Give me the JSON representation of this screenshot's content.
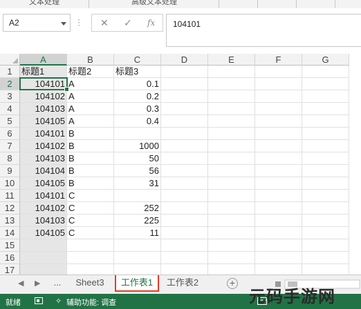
{
  "ribbon": {
    "group_left": "文本处理",
    "group_right": "高级文本处理"
  },
  "formula_bar": {
    "name_box": "A2",
    "cancel_symbol": "✕",
    "enter_symbol": "✓",
    "fx_label": "fx",
    "formula_value": "104101"
  },
  "columns": [
    "A",
    "B",
    "C",
    "D",
    "E",
    "F",
    "G"
  ],
  "selected_column": "A",
  "rows": [
    {
      "n": "1",
      "a": "标题1",
      "b": "标题2",
      "c": "标题3"
    },
    {
      "n": "2",
      "a": "104101",
      "b": "A",
      "c": "0.1"
    },
    {
      "n": "3",
      "a": "104102",
      "b": "A",
      "c": "0.2"
    },
    {
      "n": "4",
      "a": "104103",
      "b": "A",
      "c": "0.3"
    },
    {
      "n": "5",
      "a": "104105",
      "b": "A",
      "c": "0.4"
    },
    {
      "n": "6",
      "a": "104101",
      "b": "B",
      "c": ""
    },
    {
      "n": "7",
      "a": "104102",
      "b": "B",
      "c": "1000"
    },
    {
      "n": "8",
      "a": "104103",
      "b": "B",
      "c": "50"
    },
    {
      "n": "9",
      "a": "104104",
      "b": "B",
      "c": "56"
    },
    {
      "n": "10",
      "a": "104105",
      "b": "B",
      "c": "31"
    },
    {
      "n": "11",
      "a": "104101",
      "b": "C",
      "c": ""
    },
    {
      "n": "12",
      "a": "104102",
      "b": "C",
      "c": "252"
    },
    {
      "n": "13",
      "a": "104103",
      "b": "C",
      "c": "225"
    },
    {
      "n": "14",
      "a": "104105",
      "b": "C",
      "c": "11"
    },
    {
      "n": "15",
      "a": "",
      "b": "",
      "c": ""
    },
    {
      "n": "16",
      "a": "",
      "b": "",
      "c": ""
    },
    {
      "n": "17",
      "a": "",
      "b": "",
      "c": ""
    }
  ],
  "sheet_tabs": {
    "ellipsis": "...",
    "tabs": [
      "Sheet3",
      "工作表1",
      "工作表2"
    ],
    "active": "工作表1"
  },
  "status_bar": {
    "ready": "就绪",
    "accessibility": "辅助功能: 调查"
  },
  "watermark": "元码手游网",
  "colors": {
    "accent": "#217346",
    "highlight_box": "#e63a2a"
  }
}
